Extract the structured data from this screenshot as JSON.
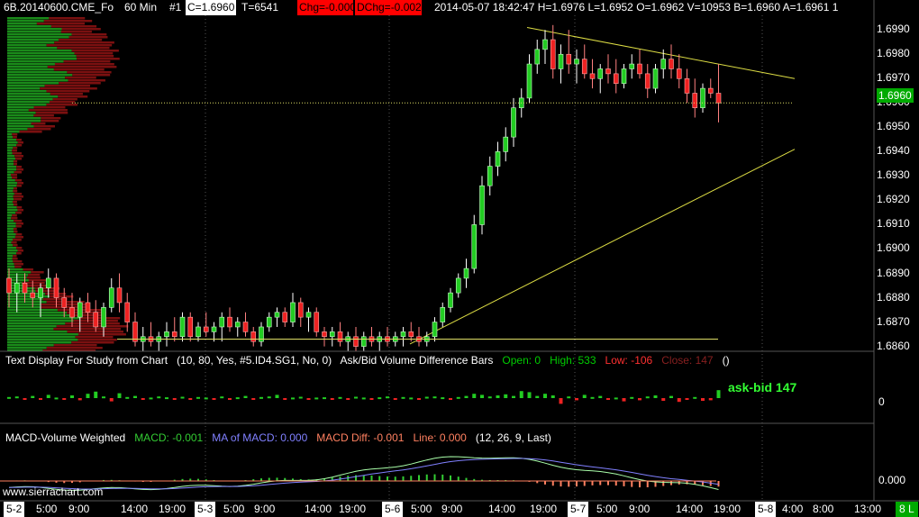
{
  "header": {
    "symbol": "6B.20140600.CME_Fo",
    "interval": "60 Min",
    "chart_no": "#1",
    "close": "C=1.6960",
    "trades": "T=6541",
    "chg": "Chg=-0.0002",
    "dchg": "DChg=-0.0020",
    "bar_info": "2014-05-07 18:42:47 H=1.6976 L=1.6952 O=1.6962 V=10953 B=1.6960 A=1.6961 1",
    "colors": {
      "chg_bg": "#ff0000",
      "close_bg": "#ffffff"
    }
  },
  "price_axis": {
    "ticks": [
      "1.6990",
      "1.6980",
      "1.6970",
      "1.6960",
      "1.6950",
      "1.6940",
      "1.6930",
      "1.6920",
      "1.6910",
      "1.6900",
      "1.6890",
      "1.6880",
      "1.6870",
      "1.6860"
    ],
    "current_price": "1.6960",
    "current_bg": "#00aa00"
  },
  "study1": {
    "title": "Text Display For Study from Chart",
    "params": "(10, 80, Yes, #5.ID4.SG1, No, 0)",
    "name": "Ask/Bid Volume Difference Bars",
    "open": "Open: 0",
    "high": "High: 533",
    "low": "Low: -106",
    "close": "Close: 147",
    "paren": "()",
    "annotation": "ask-bid  147",
    "axis_label": "0"
  },
  "study2": {
    "title": "MACD-Volume Weighted",
    "macd": "MACD: -0.001",
    "ma": "MA of MACD: 0.000",
    "diff": "MACD Diff: -0.001",
    "line": "Line: 0.000",
    "params": "(12, 26, 9, Last)",
    "axis_label": "0.000",
    "watermark": "www.sierrachart.com"
  },
  "time_axis": {
    "labels": [
      {
        "t": "5-2",
        "date": true
      },
      {
        "t": "5:00"
      },
      {
        "t": "9:00"
      },
      {
        "t": "14:00"
      },
      {
        "t": "19:00"
      },
      {
        "t": "5-3",
        "date": true
      },
      {
        "t": "5:00"
      },
      {
        "t": "9:00"
      },
      {
        "t": "14:00"
      },
      {
        "t": "19:00"
      },
      {
        "t": "5-6",
        "date": true
      },
      {
        "t": "5:00"
      },
      {
        "t": "9:00"
      },
      {
        "t": "14:00"
      },
      {
        "t": "19:00"
      },
      {
        "t": "5-7",
        "date": true
      },
      {
        "t": "5:00"
      },
      {
        "t": "9:00"
      },
      {
        "t": "14:00"
      },
      {
        "t": "19:00"
      },
      {
        "t": "5-8",
        "date": true
      },
      {
        "t": "4:00"
      },
      {
        "t": "8:00"
      },
      {
        "t": "13:00"
      }
    ],
    "corner": "8 L"
  },
  "chart_data": {
    "type": "candlestick",
    "y_range": [
      1.686,
      1.6995
    ],
    "candles": [
      [
        1.6888,
        1.6892,
        1.6876,
        1.6882
      ],
      [
        1.6882,
        1.689,
        1.6874,
        1.6886
      ],
      [
        1.6886,
        1.689,
        1.6878,
        1.6882
      ],
      [
        1.6882,
        1.6887,
        1.6876,
        1.688
      ],
      [
        1.688,
        1.6886,
        1.6872,
        1.6884
      ],
      [
        1.6884,
        1.6892,
        1.688,
        1.6888
      ],
      [
        1.6888,
        1.689,
        1.6876,
        1.688
      ],
      [
        1.688,
        1.6884,
        1.6872,
        1.6876
      ],
      [
        1.6876,
        1.6882,
        1.6868,
        1.6872
      ],
      [
        1.6872,
        1.688,
        1.6866,
        1.6878
      ],
      [
        1.6878,
        1.6882,
        1.687,
        1.6874
      ],
      [
        1.6874,
        1.6879,
        1.6866,
        1.6868
      ],
      [
        1.6868,
        1.6878,
        1.6864,
        1.6876
      ],
      [
        1.6876,
        1.6888,
        1.6874,
        1.6884
      ],
      [
        1.6884,
        1.689,
        1.6874,
        1.6878
      ],
      [
        1.6878,
        1.6882,
        1.6866,
        1.687
      ],
      [
        1.687,
        1.6874,
        1.686,
        1.6862
      ],
      [
        1.6862,
        1.6868,
        1.6858,
        1.6864
      ],
      [
        1.6864,
        1.687,
        1.686,
        1.6862
      ],
      [
        1.6862,
        1.6866,
        1.6858,
        1.6864
      ],
      [
        1.6864,
        1.687,
        1.686,
        1.6866
      ],
      [
        1.6866,
        1.6872,
        1.6862,
        1.6864
      ],
      [
        1.6864,
        1.6874,
        1.6862,
        1.6872
      ],
      [
        1.6872,
        1.6874,
        1.6862,
        1.6864
      ],
      [
        1.6864,
        1.687,
        1.6862,
        1.6868
      ],
      [
        1.6868,
        1.6874,
        1.6864,
        1.6866
      ],
      [
        1.6866,
        1.687,
        1.6862,
        1.6868
      ],
      [
        1.6868,
        1.6874,
        1.6862,
        1.6872
      ],
      [
        1.6872,
        1.6876,
        1.6866,
        1.6868
      ],
      [
        1.6868,
        1.6872,
        1.6864,
        1.687
      ],
      [
        1.687,
        1.6874,
        1.6864,
        1.6866
      ],
      [
        1.6866,
        1.6868,
        1.686,
        1.6862
      ],
      [
        1.6862,
        1.687,
        1.686,
        1.6868
      ],
      [
        1.6868,
        1.6874,
        1.6866,
        1.6872
      ],
      [
        1.6872,
        1.6876,
        1.6868,
        1.6874
      ],
      [
        1.6874,
        1.6876,
        1.6868,
        1.687
      ],
      [
        1.687,
        1.6882,
        1.6868,
        1.6878
      ],
      [
        1.6878,
        1.688,
        1.6868,
        1.6872
      ],
      [
        1.6872,
        1.6876,
        1.6866,
        1.6874
      ],
      [
        1.6874,
        1.6876,
        1.6864,
        1.6866
      ],
      [
        1.6866,
        1.6868,
        1.686,
        1.6864
      ],
      [
        1.6864,
        1.6868,
        1.686,
        1.6866
      ],
      [
        1.6866,
        1.687,
        1.686,
        1.6862
      ],
      [
        1.6862,
        1.6866,
        1.6858,
        1.6864
      ],
      [
        1.6864,
        1.6868,
        1.6858,
        1.686
      ],
      [
        1.686,
        1.6866,
        1.6858,
        1.6864
      ],
      [
        1.6864,
        1.6868,
        1.686,
        1.6862
      ],
      [
        1.6862,
        1.6866,
        1.6858,
        1.6864
      ],
      [
        1.6864,
        1.6868,
        1.686,
        1.6862
      ],
      [
        1.6862,
        1.6866,
        1.686,
        1.6864
      ],
      [
        1.6864,
        1.6868,
        1.686,
        1.6866
      ],
      [
        1.6866,
        1.687,
        1.6862,
        1.6864
      ],
      [
        1.6864,
        1.6868,
        1.686,
        1.6862
      ],
      [
        1.6862,
        1.6866,
        1.686,
        1.6864
      ],
      [
        1.6864,
        1.6872,
        1.6862,
        1.687
      ],
      [
        1.687,
        1.6878,
        1.6868,
        1.6876
      ],
      [
        1.6876,
        1.6884,
        1.6874,
        1.6882
      ],
      [
        1.6882,
        1.689,
        1.688,
        1.6888
      ],
      [
        1.6888,
        1.6896,
        1.6884,
        1.6892
      ],
      [
        1.6892,
        1.6914,
        1.689,
        1.691
      ],
      [
        1.691,
        1.693,
        1.6906,
        1.6926
      ],
      [
        1.6926,
        1.6938,
        1.6922,
        1.6934
      ],
      [
        1.6934,
        1.6944,
        1.693,
        1.694
      ],
      [
        1.694,
        1.695,
        1.6936,
        1.6946
      ],
      [
        1.6946,
        1.6962,
        1.6942,
        1.6958
      ],
      [
        1.6958,
        1.6966,
        1.6954,
        1.6962
      ],
      [
        1.6962,
        1.698,
        1.696,
        1.6976
      ],
      [
        1.6976,
        1.6986,
        1.6972,
        1.6982
      ],
      [
        1.6982,
        1.699,
        1.6976,
        1.6986
      ],
      [
        1.6986,
        1.6992,
        1.697,
        1.6974
      ],
      [
        1.6974,
        1.6984,
        1.6968,
        1.698
      ],
      [
        1.698,
        1.699,
        1.6972,
        1.6976
      ],
      [
        1.6976,
        1.6982,
        1.6968,
        1.6978
      ],
      [
        1.6978,
        1.6984,
        1.697,
        1.6972
      ],
      [
        1.6972,
        1.6978,
        1.6966,
        1.697
      ],
      [
        1.697,
        1.6976,
        1.6964,
        1.6974
      ],
      [
        1.6974,
        1.698,
        1.6968,
        1.6972
      ],
      [
        1.6972,
        1.6978,
        1.6964,
        1.6968
      ],
      [
        1.6968,
        1.6976,
        1.6966,
        1.6974
      ],
      [
        1.6974,
        1.698,
        1.697,
        1.6976
      ],
      [
        1.6976,
        1.6982,
        1.697,
        1.6972
      ],
      [
        1.6972,
        1.6976,
        1.6962,
        1.6966
      ],
      [
        1.6966,
        1.6976,
        1.6964,
        1.6974
      ],
      [
        1.6974,
        1.6982,
        1.697,
        1.6978
      ],
      [
        1.6978,
        1.6984,
        1.697,
        1.6974
      ],
      [
        1.6974,
        1.698,
        1.6966,
        1.697
      ],
      [
        1.697,
        1.6974,
        1.696,
        1.6964
      ],
      [
        1.6964,
        1.697,
        1.6954,
        1.6958
      ],
      [
        1.6958,
        1.6968,
        1.6956,
        1.6966
      ],
      [
        1.6966,
        1.697,
        1.6962,
        1.6964
      ],
      [
        1.6964,
        1.6976,
        1.6952,
        1.696
      ]
    ],
    "ask_bid_diff": [
      20,
      30,
      -15,
      40,
      -25,
      60,
      10,
      -30,
      50,
      -40,
      80,
      120,
      30,
      -60,
      90,
      20,
      40,
      -20,
      10,
      30,
      15,
      -10,
      25,
      -15,
      20,
      10,
      -10,
      30,
      -20,
      15,
      40,
      -25,
      20,
      30,
      60,
      -20,
      10,
      25,
      -30,
      10,
      15,
      -10,
      20,
      -15,
      25,
      10,
      -20,
      15,
      30,
      -25,
      20,
      10,
      -15,
      25,
      30,
      15,
      -10,
      20,
      40,
      80,
      60,
      30,
      50,
      70,
      40,
      130,
      110,
      40,
      80,
      50,
      -106,
      30,
      -40,
      60,
      20,
      40,
      -30,
      10,
      -60,
      20,
      -40,
      30,
      50,
      -50,
      40,
      -70,
      -30,
      20,
      -50,
      -40,
      147
    ],
    "macd_colors": {
      "macd": "#aaffaa",
      "ma": "#8080ff",
      "diff_up": "#33cc33",
      "diff_down": "#ff8060",
      "line": "#ff8060"
    },
    "trend_lines": [
      {
        "from": [
          1.6991
        ],
        "to": [
          1.697
        ],
        "color": "#dddd44"
      },
      {
        "from": [
          1.6863
        ],
        "to": [
          1.6941
        ],
        "color": "#dddd44"
      }
    ]
  }
}
